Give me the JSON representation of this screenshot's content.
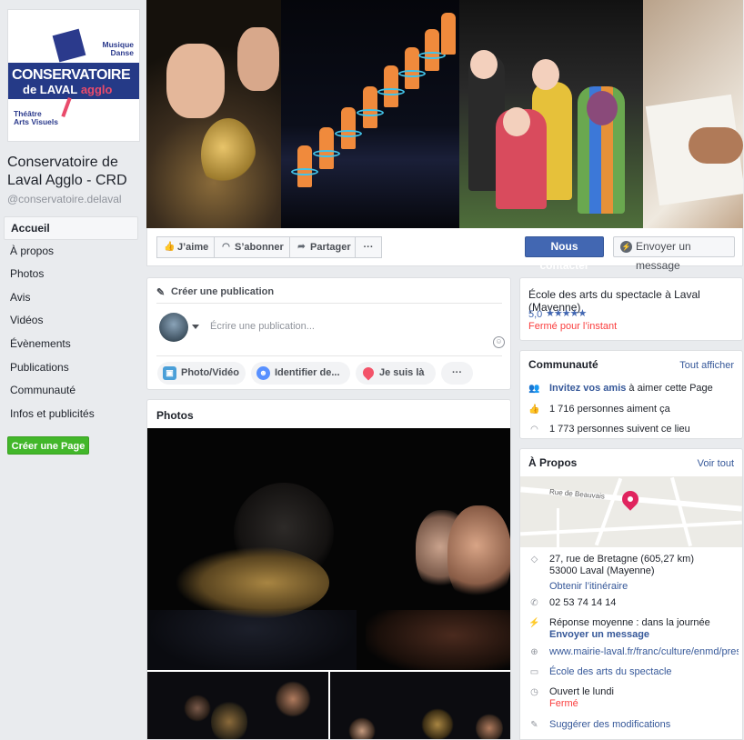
{
  "logo": {
    "top_text": "Musique\nDanse",
    "main_line1": "CONSERVATOIRE",
    "main_line2_a": "de ",
    "main_line2_b": "LAVAL",
    "main_line2_c": " agglo",
    "bottom_text": "Théâtre\nArts Visuels"
  },
  "page": {
    "name": "Conservatoire de Laval Agglo - CRD",
    "handle": "@conservatoire.delaval"
  },
  "nav": {
    "items": [
      "Accueil",
      "À propos",
      "Photos",
      "Avis",
      "Vidéos",
      "Évènements",
      "Publications",
      "Communauté",
      "Infos et publicités"
    ],
    "create_page": "Créer une Page"
  },
  "actions": {
    "like": "J’aime",
    "subscribe": "S’abonner",
    "share": "Partager",
    "more": "···",
    "contact": "Nous contacter",
    "message": "Envoyer un message"
  },
  "composer": {
    "title": "Créer une publication",
    "placeholder": "Écrire une publication...",
    "photo_video": "Photo/Vidéo",
    "tag": "Identifier de...",
    "checkin": "Je suis là",
    "more": "···"
  },
  "photos": {
    "title": "Photos"
  },
  "info": {
    "category": "École des arts du spectacle à Laval (Mayenne)",
    "rating": "5,0",
    "stars": "★★★★★",
    "status": "Fermé pour l’instant"
  },
  "community": {
    "title": "Communauté",
    "see_all": "Tout afficher",
    "invite_link": "Invitez vos amis",
    "invite_rest": " à aimer cette Page",
    "likes": "1 716 personnes aiment ça",
    "follows": "1 773 personnes suivent ce lieu"
  },
  "about": {
    "title": "À Propos",
    "see_all": "Voir tout",
    "map_street": "Rue de Beauvais",
    "address_line1": "27, rue de Bretagne (605,27 km)",
    "address_line2": "53000 Laval (Mayenne)",
    "directions": "Obtenir l’itinéraire",
    "phone": "02 53 74 14 14",
    "response": "Réponse moyenne : dans la journée",
    "send_message": "Envoyer un message",
    "website": "www.mairie-laval.fr/franc/culture/enmd/prese",
    "category": "École des arts du spectacle",
    "hours": "Ouvert le lundi",
    "hours_status": "Fermé",
    "suggest": "Suggérer des modifications"
  },
  "colors": {
    "brand_blue": "#4267b2",
    "link": "#365899",
    "green": "#42b72a",
    "red": "#fa3e3e"
  }
}
